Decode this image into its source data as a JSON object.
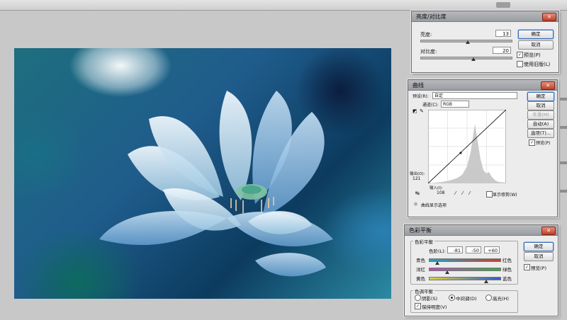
{
  "brightness_contrast": {
    "title": "亮度/对比度",
    "brightness_label": "亮度:",
    "brightness_value": "13",
    "contrast_label": "对比度:",
    "contrast_value": "20",
    "ok": "确定",
    "cancel": "取消",
    "preview": "预览(P)",
    "legacy": "使用旧版(L)"
  },
  "curves": {
    "title": "曲线",
    "preset_label": "预设(R):",
    "preset_value": "自定",
    "channel_label": "通道(C):",
    "channel_value": "RGB",
    "output_label": "输出(O):",
    "output_value": "121",
    "input_label": "输入(I):",
    "input_value": "108",
    "show_clipping": "显示修剪(W)",
    "curve_display": "曲线显示选项",
    "ok": "确定",
    "cancel": "取消",
    "smooth": "平滑(M)",
    "auto": "自动(A)",
    "options": "选项(T)...",
    "preview": "预览(P)"
  },
  "color_balance": {
    "title": "色彩平衡",
    "group_label": "色彩平衡",
    "levels_label": "色阶(L):",
    "levels": [
      "-81",
      "-50",
      "+60"
    ],
    "cyan": "青色",
    "red": "红色",
    "magenta": "洋红",
    "green": "绿色",
    "yellow": "黄色",
    "blue": "蓝色",
    "tone_group": "色调平衡",
    "shadows": "阴影(S)",
    "midtones": "中间调(D)",
    "highlights": "高光(H)",
    "preserve": "保持明度(V)",
    "ok": "确定",
    "cancel": "取消",
    "preview": "预览(P)"
  },
  "colors": {
    "title_close": "#c0402a",
    "cyan": "#1aa6c8",
    "red": "#d23a2a",
    "magenta": "#b84fb8",
    "green": "#3aa84a",
    "yellow": "#e0d23a",
    "blue": "#2a5ad8"
  }
}
